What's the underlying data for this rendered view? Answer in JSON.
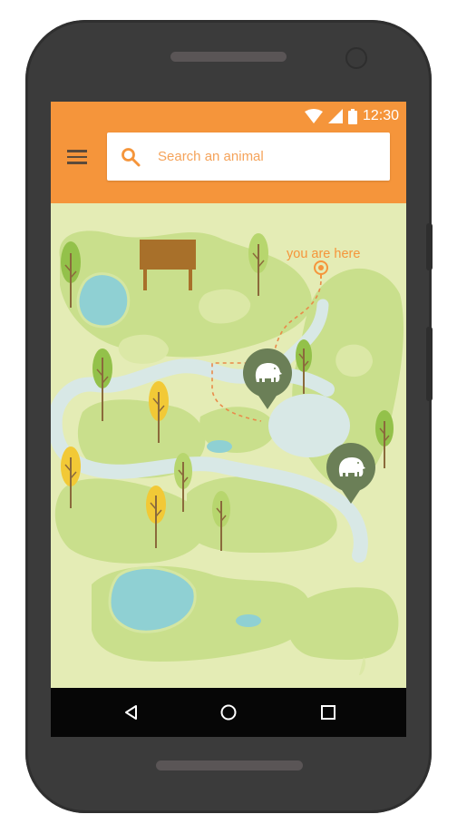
{
  "status_bar": {
    "time": "12:30"
  },
  "search": {
    "placeholder": "Search an animal"
  },
  "map": {
    "you_are_here_label": "you are here"
  },
  "colors": {
    "accent": "#f5953b",
    "map_background": "#e4ecb5",
    "marker": "#6b7f57",
    "river": "#d8e8e6",
    "lake": "#8fd0d3"
  },
  "icons": {
    "menu": "menu-icon",
    "search": "search-icon",
    "location": "location-pin-icon",
    "animal_marker": "elephant-icon",
    "back": "back-icon",
    "home": "home-icon",
    "recents": "recents-icon"
  }
}
